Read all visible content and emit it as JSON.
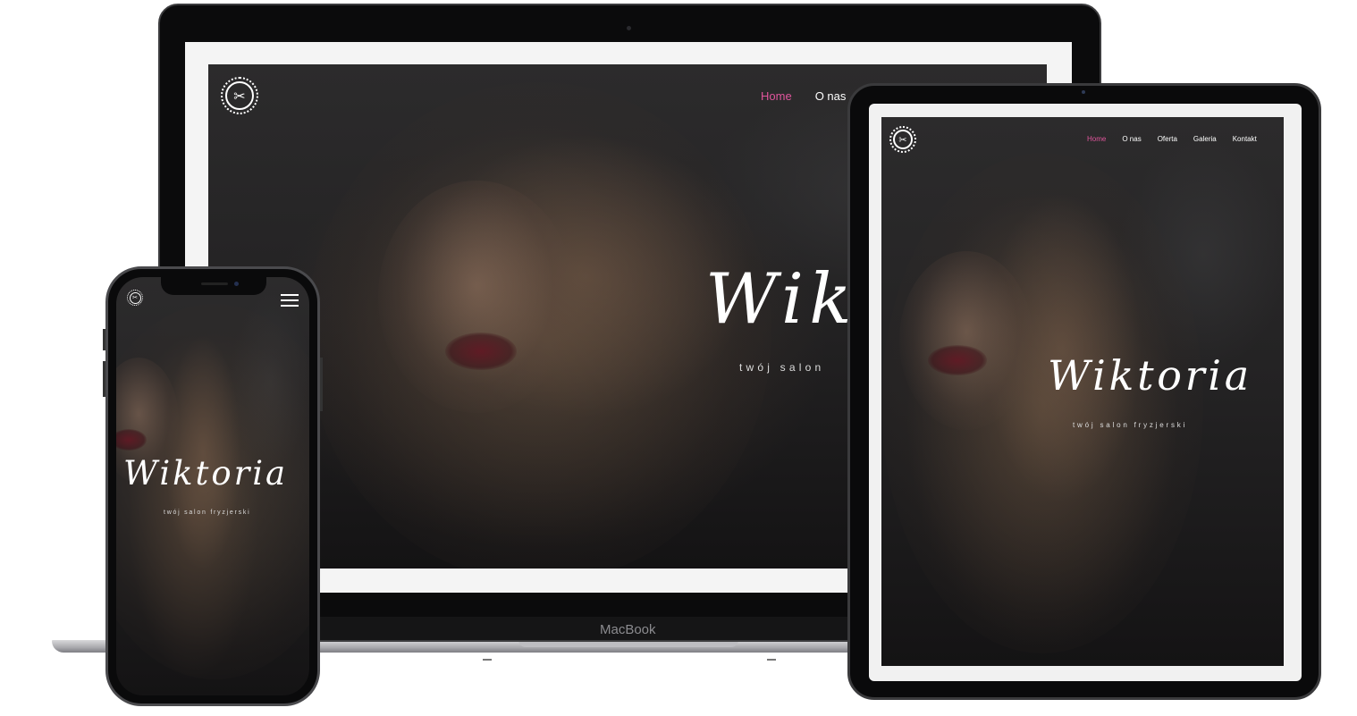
{
  "site": {
    "brand": "Wiktoria",
    "tagline": "twój salon fryzjerski",
    "accent_color": "#e0559c",
    "logo_icon": "scissors-icon"
  },
  "laptop": {
    "label": "MacBook",
    "nav": {
      "home": "Home",
      "about": "O nas"
    },
    "brand_visible": "Wikt",
    "tagline_visible": "twój salon"
  },
  "tablet": {
    "nav": {
      "home": "Home",
      "about": "O nas",
      "offer": "Oferta",
      "gallery": "Galeria",
      "contact": "Kontakt"
    }
  },
  "phone": {
    "menu_icon": "hamburger-menu-icon"
  }
}
